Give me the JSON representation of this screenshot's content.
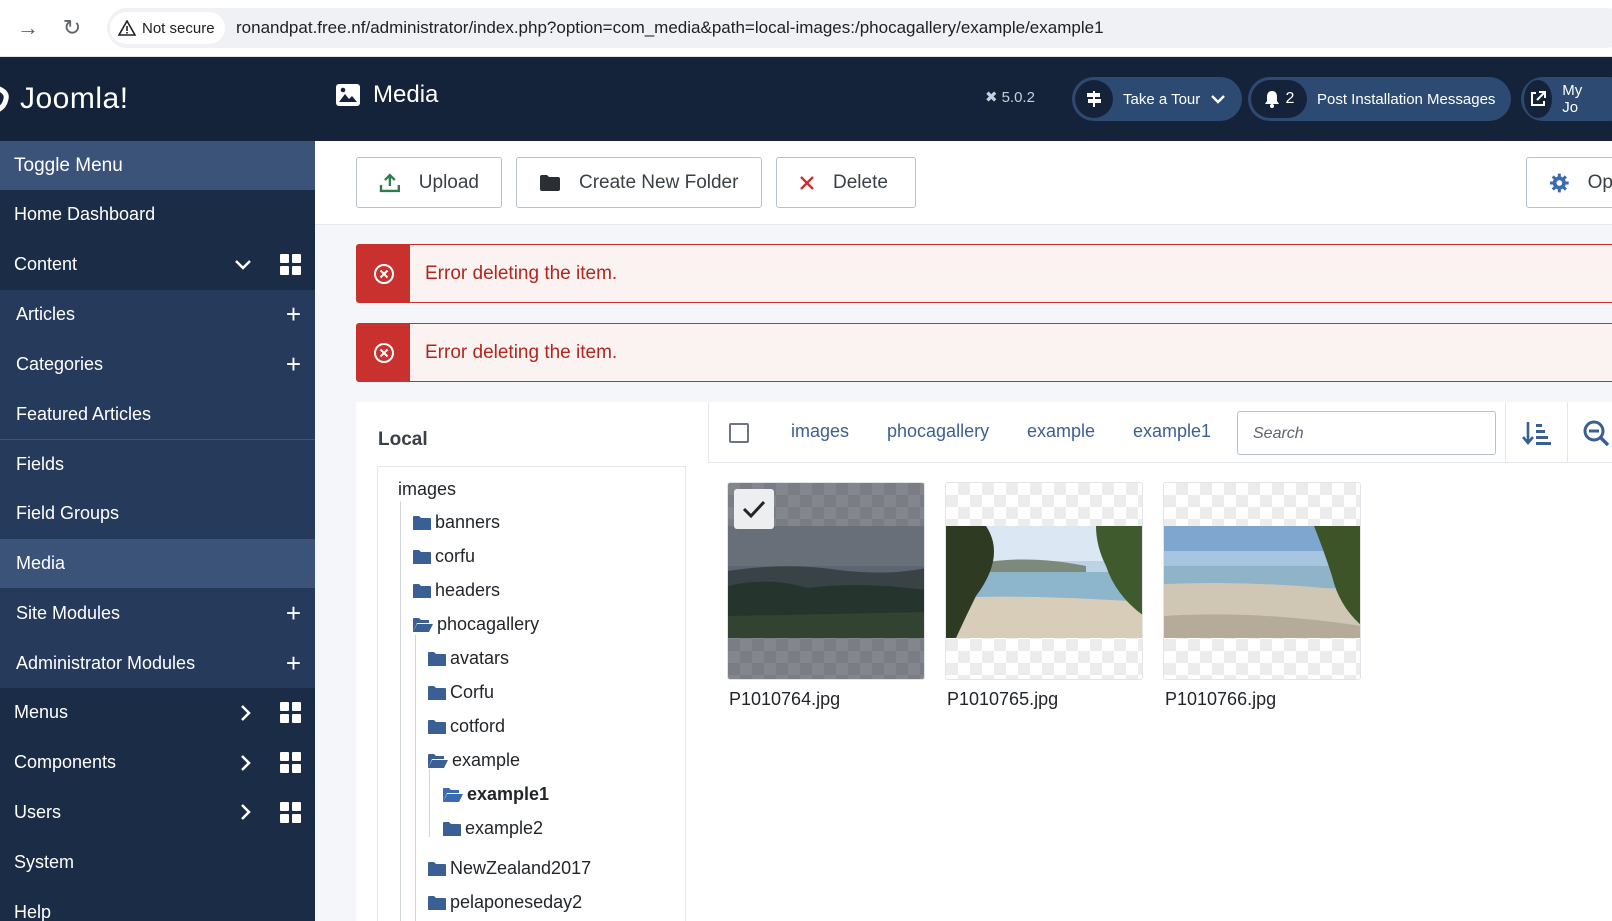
{
  "browser": {
    "security_label": "Not secure",
    "url": "ronandpat.free.nf/administrator/index.php?option=com_media&path=local-images:/phocagallery/example/example1"
  },
  "sidebar": {
    "brand": "Joomla!",
    "toggle_menu": "Toggle Menu",
    "items": [
      {
        "label": "Home Dashboard"
      },
      {
        "label": "Content"
      },
      {
        "label": "Articles"
      },
      {
        "label": "Categories"
      },
      {
        "label": "Featured Articles"
      },
      {
        "label": "Fields"
      },
      {
        "label": "Field Groups"
      },
      {
        "label": "Media"
      },
      {
        "label": "Site Modules"
      },
      {
        "label": "Administrator Modules"
      },
      {
        "label": "Menus"
      },
      {
        "label": "Components"
      },
      {
        "label": "Users"
      },
      {
        "label": "System"
      },
      {
        "label": "Help"
      }
    ]
  },
  "header": {
    "title": "Media",
    "version": "5.0.2",
    "tour_label": "Take a Tour",
    "notifications_count": "2",
    "post_install_label": "Post Installation Messages",
    "my_site_label": "My Jo"
  },
  "toolbar": {
    "upload": "Upload",
    "create_folder": "Create New Folder",
    "delete": "Delete",
    "options": "Op"
  },
  "alerts": [
    {
      "message": "Error deleting the item."
    },
    {
      "message": "Error deleting the item."
    }
  ],
  "tree": {
    "title": "Local",
    "root": "images",
    "nodes": [
      "banners",
      "corfu",
      "headers",
      "phocagallery",
      "avatars",
      "Corfu",
      "cotford",
      "example",
      "example1",
      "example2",
      "NewZealand2017",
      "pelaponeseday2"
    ]
  },
  "breadcrumbs": [
    "images",
    "phocagallery",
    "example",
    "example1"
  ],
  "search": {
    "placeholder": "Search"
  },
  "files": [
    {
      "name": "P1010764.jpg",
      "selected": true
    },
    {
      "name": "P1010765.jpg",
      "selected": false
    },
    {
      "name": "P1010766.jpg",
      "selected": false
    }
  ],
  "colors": {
    "sidebar": "#1b2c47",
    "header": "#15233a",
    "alert": "#c8312e",
    "link": "#3a5f94"
  }
}
